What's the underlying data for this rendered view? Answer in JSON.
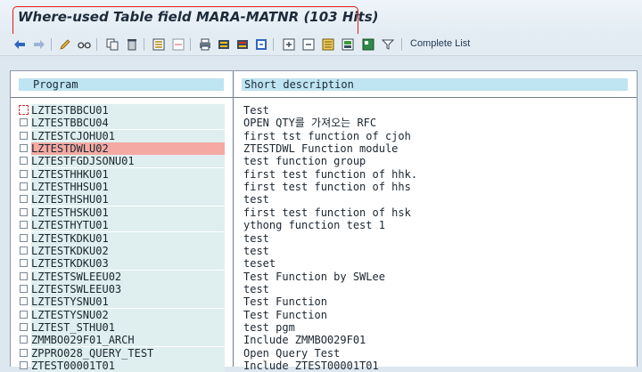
{
  "window": {
    "title": "Where-used Table field MARA-MATNR (103 Hits)"
  },
  "toolbar": {
    "buttons": [
      {
        "icon": "back-arrow-icon"
      },
      {
        "icon": "forward-arrow-icon"
      },
      {
        "icon": "pencil-icon"
      },
      {
        "icon": "glasses-icon"
      },
      {
        "icon": "copy-icon"
      },
      {
        "icon": "trash-icon"
      },
      {
        "icon": "select-all-icon"
      },
      {
        "icon": "deselect-icon"
      },
      {
        "icon": "print-icon"
      },
      {
        "icon": "find-icon"
      },
      {
        "icon": "find-next-icon"
      },
      {
        "icon": "expand-icon"
      },
      {
        "icon": "collapse-icon"
      },
      {
        "icon": "list-icon"
      },
      {
        "icon": "export-icon"
      },
      {
        "icon": "filter-icon"
      }
    ],
    "complete_list_label": "Complete List"
  },
  "table": {
    "headers": {
      "program": "Program",
      "description": "Short description"
    },
    "selected_row": 3,
    "rows": [
      {
        "program": "LZTESTBBCU01",
        "description": "Test"
      },
      {
        "program": "LZTESTBBCU04",
        "description": "OPEN QTY를 가져오는 RFC"
      },
      {
        "program": "LZTESTCJOHU01",
        "description": "first tst function of cjoh"
      },
      {
        "program": "LZTESTDWLU02",
        "description": "ZTESTDWL Function module"
      },
      {
        "program": "LZTESTFGDJSONU01",
        "description": "test function group"
      },
      {
        "program": "LZTESTHHKU01",
        "description": "first test function of hhk."
      },
      {
        "program": "LZTESTHHSU01",
        "description": "first test function of hhs"
      },
      {
        "program": "LZTESTHSHU01",
        "description": "test"
      },
      {
        "program": "LZTESTHSKU01",
        "description": "first test function of hsk"
      },
      {
        "program": "LZTESTHYTU01",
        "description": "ythong function test 1"
      },
      {
        "program": "LZTESTKDKU01",
        "description": "test"
      },
      {
        "program": "LZTESTKDKU02",
        "description": "test"
      },
      {
        "program": "LZTESTKDKU03",
        "description": "teset"
      },
      {
        "program": "LZTESTSWLEEU02",
        "description": "Test Function by SWLee"
      },
      {
        "program": "LZTESTSWLEEU03",
        "description": "test"
      },
      {
        "program": "LZTESTYSNU01",
        "description": "Test Function"
      },
      {
        "program": "LZTESTYSNU02",
        "description": "Test Function"
      },
      {
        "program": "LZTEST_STHU01",
        "description": "test pgm"
      },
      {
        "program": "ZMMBO029F01_ARCH",
        "description": "Include ZMMBO029F01"
      },
      {
        "program": "ZPPRO028_QUERY_TEST",
        "description": "Open Query Test"
      },
      {
        "program": "ZTEST00001T01",
        "description": "Include ZTEST00001T01"
      }
    ]
  }
}
